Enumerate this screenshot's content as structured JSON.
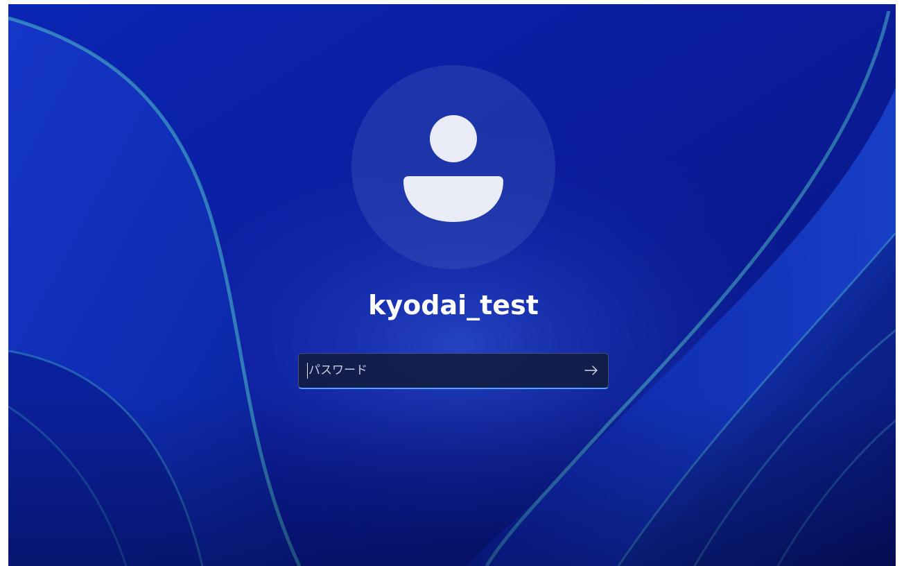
{
  "user": {
    "name": "kyodai_test",
    "avatar_icon": "person-icon"
  },
  "password": {
    "placeholder": "パスワード",
    "value": "",
    "submit_icon": "arrow-right-icon"
  },
  "colors": {
    "background": "#0a1ea0",
    "accent": "#4fa6ff",
    "text": "#ffffff"
  }
}
